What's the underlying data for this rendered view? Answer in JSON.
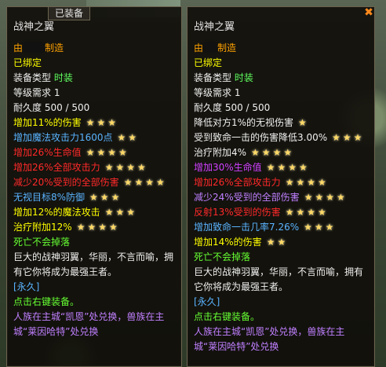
{
  "left": {
    "equipped_tag": "已装备",
    "title": "战神之翼",
    "crafted_suffix": "制造",
    "crafted_prefix": "由",
    "bound": "已绑定",
    "type_label": "装备类型",
    "type_value": "时装",
    "level": "等级需求 1",
    "durability": "耐久度 500 / 500",
    "props": [
      {
        "text": "增加11%的伤害",
        "color": "yellow",
        "stars": "★★★"
      },
      {
        "text": "增加魔法攻击力1600点",
        "color": "blue",
        "stars": "★★"
      },
      {
        "text": "增加26%生命值",
        "color": "red",
        "stars": "★★★★"
      },
      {
        "text": "增加26%全部攻击力",
        "color": "red",
        "stars": "★★★★"
      },
      {
        "text": "减少20%受到的全部伤害",
        "color": "red",
        "stars": "★★★★"
      },
      {
        "text": "无视目标8%防御",
        "color": "blue",
        "stars": "★★★"
      },
      {
        "text": "增加12%的魔法攻击",
        "color": "yellow",
        "stars": "★★★"
      },
      {
        "text": "治疗附加12%",
        "color": "yellow",
        "stars": "★★★★"
      }
    ],
    "no_drop": "死亡不会掉落",
    "desc": "巨大的战神羽翼，华丽，不言而喻，拥有它你将成为最强王者。",
    "duration": "[永久]",
    "equip_hint": "点击右键装备。",
    "exchange": "人族在主城“凯恩”处兑换，兽族在主城“莱因哈特”处兑换"
  },
  "right": {
    "title": "战神之翼",
    "crafted_suffix": "制造",
    "crafted_prefix": "由",
    "bound": "已绑定",
    "type_label": "装备类型",
    "type_value": "时装",
    "level": "等级需求 1",
    "durability": "耐久度 500 / 500",
    "props": [
      {
        "text": "降低对方1%的无视伤害",
        "color": "white",
        "stars": "★"
      },
      {
        "text": "受到致命一击的伤害降低3.00%",
        "color": "white",
        "stars": "★★★"
      },
      {
        "text": "治疗附加4%",
        "color": "white",
        "stars": "★★★★"
      },
      {
        "text": "增加30%生命值",
        "color": "purple",
        "stars": "★★★★"
      },
      {
        "text": "增加26%全部攻击力",
        "color": "red",
        "stars": "★★★★"
      },
      {
        "text": "减少24%受到的全部伤害",
        "color": "lilac",
        "stars": "★★★★"
      },
      {
        "text": "反射13%受到的伤害",
        "color": "red",
        "stars": "★★★★"
      },
      {
        "text": "增加致命一击几率7.26%",
        "color": "blue",
        "stars": "★★★"
      },
      {
        "text": "增加14%的伤害",
        "color": "yellow",
        "stars": "★★"
      }
    ],
    "no_drop": "死亡不会掉落",
    "desc": "巨大的战神羽翼，华丽，不言而喻，拥有它你将成为最强王者。",
    "duration": "[永久]",
    "equip_hint": "点击右键装备。",
    "exchange": "人族在主城“凯恩”处兑换，兽族在主城“莱因哈特”处兑换"
  },
  "colors": {
    "star": "#ffd966",
    "title": "#e0e0e0",
    "close": "#ff8a1c"
  }
}
